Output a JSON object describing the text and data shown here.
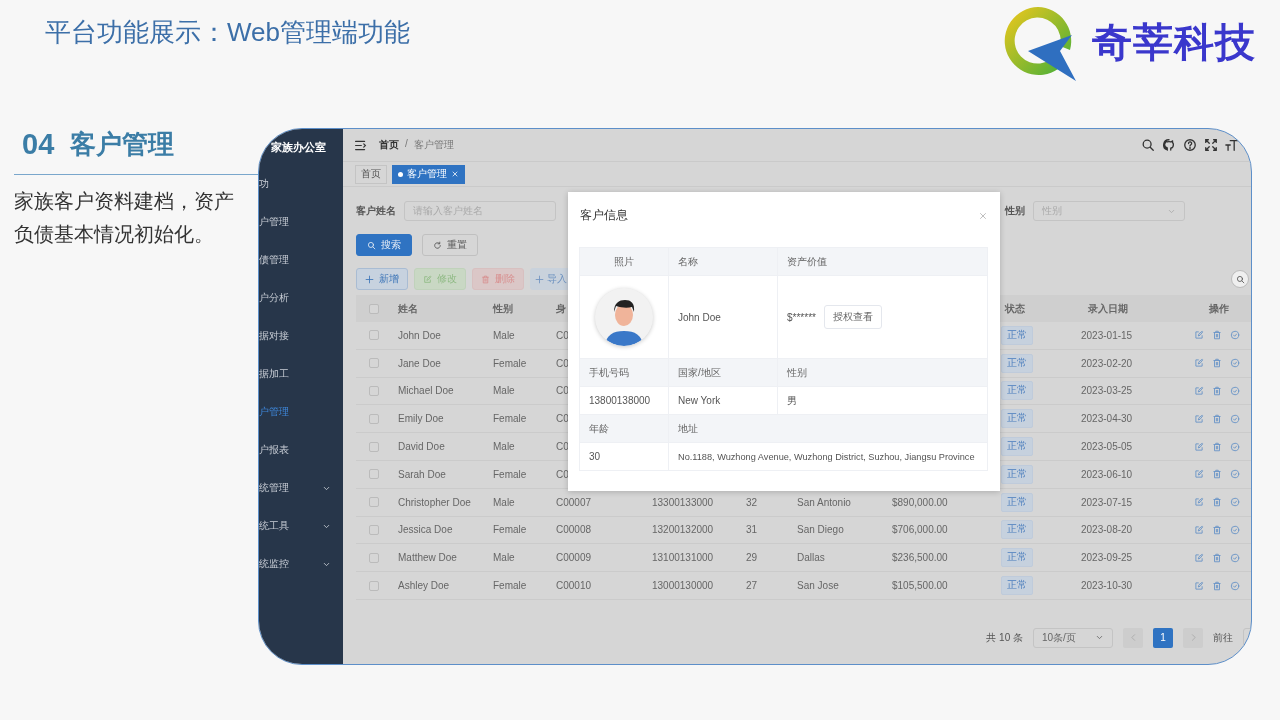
{
  "slide": {
    "title": "平台功能展示：Web管理端功能",
    "logo_text": "奇莘科技",
    "section_number": "04",
    "section_title": "客户管理",
    "description": "家族客户资料建档，资产负债基本情况初始化。"
  },
  "app": {
    "sidebar": {
      "title": "家族办公室",
      "items": [
        {
          "label": "功",
          "selected": false,
          "expandable": false
        },
        {
          "label": "户管理",
          "selected": false,
          "expandable": false
        },
        {
          "label": "债管理",
          "selected": false,
          "expandable": false
        },
        {
          "label": "户分析",
          "selected": false,
          "expandable": false
        },
        {
          "label": "据对接",
          "selected": false,
          "expandable": false
        },
        {
          "label": "据加工",
          "selected": false,
          "expandable": false
        },
        {
          "label": "户管理",
          "selected": true,
          "expandable": false
        },
        {
          "label": "户报表",
          "selected": false,
          "expandable": false
        },
        {
          "label": "统管理",
          "selected": false,
          "expandable": true
        },
        {
          "label": "统工具",
          "selected": false,
          "expandable": true
        },
        {
          "label": "统监控",
          "selected": false,
          "expandable": true
        }
      ]
    },
    "breadcrumb": [
      "首页",
      "客户管理"
    ],
    "breadcrumb_separator": "/",
    "tabs": [
      {
        "label": "首页",
        "selected": false,
        "closable": false
      },
      {
        "label": "客户管理",
        "selected": true,
        "closable": true
      }
    ],
    "filters": [
      {
        "kind": "input",
        "label": "客户姓名",
        "placeholder": "请输入客户姓名"
      },
      {
        "kind": "select",
        "label": "性别",
        "placeholder": "性别"
      }
    ],
    "search_buttons": [
      {
        "kind": "primary",
        "label": "搜索"
      },
      {
        "kind": "default",
        "label": "重置"
      }
    ],
    "actions": [
      {
        "kind": "add",
        "label": "新增"
      },
      {
        "kind": "edit",
        "label": "修改"
      },
      {
        "kind": "delete",
        "label": "删除"
      },
      {
        "kind": "import",
        "label": "导入"
      }
    ],
    "table": {
      "all_checked": false,
      "columns": {
        "name": "姓名",
        "gender": "性别",
        "id": "身",
        "status": "状态",
        "date": "录入日期",
        "actions": "操作"
      },
      "rows": [
        {
          "checked": false,
          "name": "John Doe",
          "gender": "Male",
          "id": "C0",
          "status": "正常",
          "date": "2023-01-15"
        },
        {
          "checked": false,
          "name": "Jane Doe",
          "gender": "Female",
          "id": "C0",
          "status": "正常",
          "date": "2023-02-20"
        },
        {
          "checked": false,
          "name": "Michael Doe",
          "gender": "Male",
          "id": "C0",
          "status": "正常",
          "date": "2023-03-25"
        },
        {
          "checked": false,
          "name": "Emily Doe",
          "gender": "Female",
          "id": "C0",
          "status": "正常",
          "date": "2023-04-30"
        },
        {
          "checked": false,
          "name": "David Doe",
          "gender": "Male",
          "id": "C0",
          "status": "正常",
          "date": "2023-05-05"
        },
        {
          "checked": false,
          "name": "Sarah Doe",
          "gender": "Female",
          "id": "C0",
          "status": "正常",
          "date": "2023-06-10"
        },
        {
          "checked": false,
          "name": "Christopher Doe",
          "gender": "Male",
          "id": "C00007",
          "phone": "13300133000",
          "age": "32",
          "city": "San Antonio",
          "asset": "$890,000.00",
          "status": "正常",
          "date": "2023-07-15"
        },
        {
          "checked": false,
          "name": "Jessica Doe",
          "gender": "Female",
          "id": "C00008",
          "phone": "13200132000",
          "age": "31",
          "city": "San Diego",
          "asset": "$706,000.00",
          "status": "正常",
          "date": "2023-08-20"
        },
        {
          "checked": false,
          "name": "Matthew Doe",
          "gender": "Male",
          "id": "C00009",
          "phone": "13100131000",
          "age": "29",
          "city": "Dallas",
          "asset": "$236,500.00",
          "status": "正常",
          "date": "2023-09-25"
        },
        {
          "checked": false,
          "name": "Ashley Doe",
          "gender": "Female",
          "id": "C00010",
          "phone": "13000130000",
          "age": "27",
          "city": "San Jose",
          "asset": "$105,500.00",
          "status": "正常",
          "date": "2023-10-30"
        }
      ]
    },
    "pagination": {
      "total": "共 10 条",
      "page_size": "10条/页",
      "pages": [
        {
          "label": "1",
          "selected": true
        }
      ],
      "goto_label": "前往"
    },
    "modal": {
      "title": "客户信息",
      "photo_label": "照片",
      "name_label": "名称",
      "asset_label": "资产价值",
      "name": "John Doe",
      "asset": "$******",
      "reveal_button": "授权查看",
      "phone_label": "手机号码",
      "region_label": "国家/地区",
      "gender_label": "性别",
      "phone": "13800138000",
      "region": "New York",
      "gender": "男",
      "age_label": "年龄",
      "address_label": "地址",
      "age": "30",
      "address": "No.1188, Wuzhong Avenue, Wuzhong District, Suzhou, Jiangsu Province"
    }
  }
}
